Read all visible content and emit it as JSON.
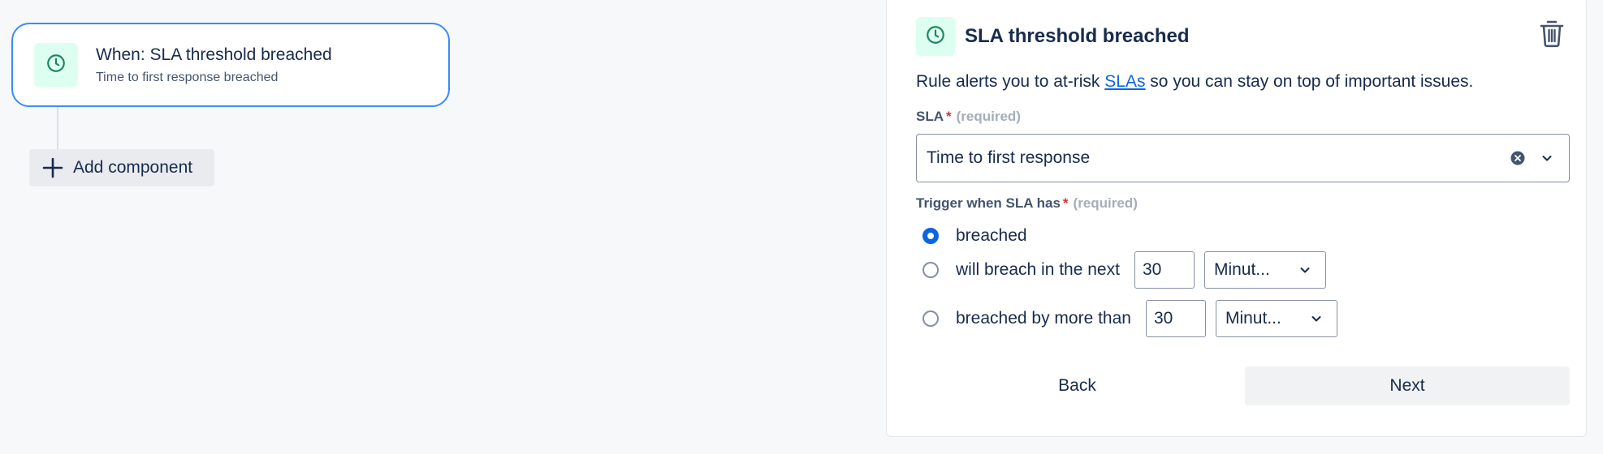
{
  "canvas": {
    "trigger": {
      "title": "When: SLA threshold breached",
      "subtitle": "Time to first response breached",
      "icon": "clock-icon"
    },
    "add_component_label": "Add component"
  },
  "panel": {
    "title": "SLA threshold breached",
    "icon": "clock-icon",
    "delete_icon": "trash-icon",
    "description_before": "Rule alerts you to at-risk ",
    "description_link": "SLAs",
    "description_after": " so you can stay on top of important issues.",
    "sla_field": {
      "label": "SLA",
      "required_star": "*",
      "required_text": "(required)",
      "value": "Time to first response"
    },
    "trigger_field": {
      "label": "Trigger when SLA has",
      "required_star": "*",
      "required_text": "(required)",
      "options": [
        {
          "label": "breached",
          "checked": true
        },
        {
          "label": "will breach in the next",
          "checked": false,
          "amount": "30",
          "unit": "Minut..."
        },
        {
          "label": "breached by more than",
          "checked": false,
          "amount": "30",
          "unit": "Minut..."
        }
      ]
    },
    "back_label": "Back",
    "next_label": "Next"
  },
  "colors": {
    "accent": "#0c66e4",
    "selected_border": "#388bff",
    "icon_bg": "#dcfff1",
    "icon_fg": "#1f845a",
    "required": "#c9372c"
  }
}
